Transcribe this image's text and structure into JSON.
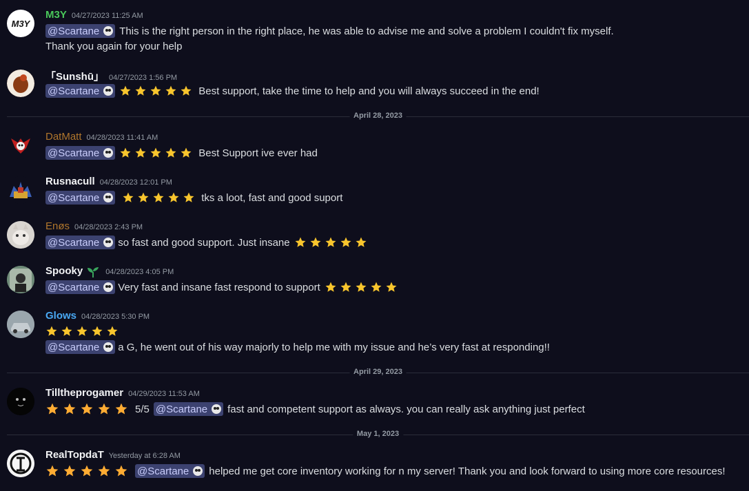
{
  "mention_label": "@Scartane",
  "colors": {
    "accent_mention_bg": "#3c4270",
    "star": "#f8c52d",
    "username_green": "#49c75a",
    "username_brown": "#b0762c",
    "username_blue": "#49a8f3",
    "username_white": "#f2f3f5"
  },
  "separators": {
    "apr28": "April 28, 2023",
    "apr29": "April 29, 2023",
    "may1": "May 1, 2023"
  },
  "messages": [
    {
      "username": "M3Y",
      "timestamp": "04/27/2023 11:25 AM",
      "line1": "This is the right person in the right place, he was able to advise me and solve a problem I couldn't fix myself.",
      "line2": "Thank you again for your help",
      "avatar_text": "M3Y"
    },
    {
      "username": "「Sunshū」",
      "timestamp": "04/27/2023 1:56 PM",
      "text": "Best support, take the time to help and you will always succeed in the end!",
      "rating_stars": 5
    },
    {
      "username": "DatMatt",
      "timestamp": "04/28/2023 11:41 AM",
      "text": "Best Support ive ever had",
      "rating_stars": 5
    },
    {
      "username": "Rusnacull",
      "timestamp": "04/28/2023 12:01 PM",
      "text": "tks a loot, fast and good suport",
      "rating_stars": 5
    },
    {
      "username": "Enøs",
      "timestamp": "04/28/2023 2:43 PM",
      "text": "so fast and good support. Just insane",
      "rating_stars": 5
    },
    {
      "username": "Spooky",
      "timestamp": "04/28/2023 4:05 PM",
      "text": "Very fast and insane fast respond to support",
      "rating_stars": 5
    },
    {
      "username": "Glows",
      "timestamp": "04/28/2023 5:30 PM",
      "text": "a G, he went out of his way majorly to help me with my issue and he’s very fast at responding!!",
      "rating_stars": 5
    },
    {
      "username": "Tilltheprogamer",
      "timestamp": "04/29/2023 11:53 AM",
      "prefix": "5/5",
      "text": "fast and competent support as always. you can really ask anything just perfect",
      "rating_stars": 5
    },
    {
      "username": "RealTopdaT",
      "timestamp": "Yesterday at 6:28 AM",
      "text": "helped me get core inventory working for n my server! Thank you and look forward to using more core resources!",
      "rating_stars": 5
    }
  ]
}
